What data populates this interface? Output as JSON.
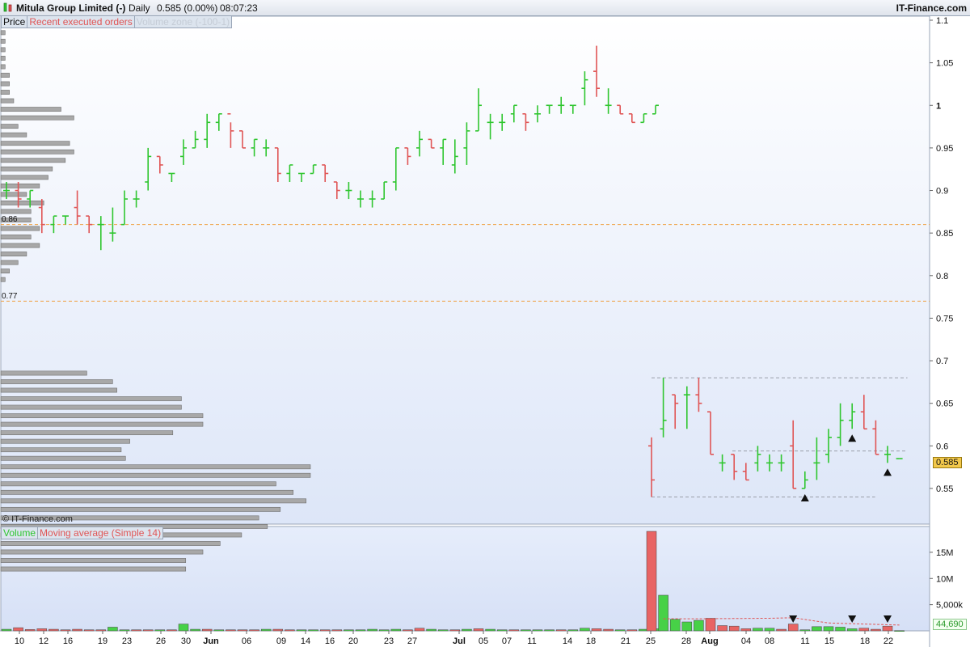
{
  "header": {
    "instrument": "Mitula Group Limited (-)",
    "period": "Daily",
    "last": "0.585 (0.00%)",
    "time": "08:07:23",
    "brand": "IT-Finance.com"
  },
  "price_panel": {
    "tab_price": "Price",
    "tab_trades": "Recent executed orders",
    "tab_volume_profile": "Volume zone (-100-1)",
    "watermark": "© IT-Finance.com",
    "level_a": "0.86",
    "level_b": "0.77",
    "last_price_tag": "0.585"
  },
  "volume_panel": {
    "tab_volume": "Volume",
    "tab_ma": "Moving average (Simple 14)",
    "last_volume_tag": "44,690"
  },
  "colors": {
    "up": "#2fc62f",
    "down": "#e05555",
    "volume_up": "#47d147",
    "volume_down": "#e86464",
    "profile_bar": "#a8a8a8",
    "level_line": "#f0a040",
    "tag_bg": "#f2c84b",
    "panel_bg_top": "#ffffff",
    "panel_bg_bottom": "#dde6f8"
  },
  "chart_data": [
    {
      "type": "ohlc",
      "ylim": [
        0.53,
        1.1
      ],
      "y_ticks": [
        "1.1",
        "1.05",
        "1",
        "0.95",
        "0.9",
        "0.85",
        "0.8",
        "0.75",
        "0.7",
        "0.65",
        "0.6",
        "0.55"
      ],
      "x_ticks": [
        "10",
        "12",
        "16",
        "19",
        "23",
        "26",
        "30",
        "Jun",
        "06",
        "09",
        "14",
        "16",
        "20",
        "23",
        "27",
        "Jul",
        "05",
        "07",
        "11",
        "14",
        "18",
        "21",
        "25",
        "28",
        "Aug",
        "04",
        "08",
        "11",
        "15",
        "18",
        "22"
      ],
      "horizontal_levels": [
        0.86,
        0.77
      ],
      "dashed_box_levels": [
        0.68,
        0.594,
        0.54
      ],
      "bars": [
        [
          0.9,
          0.91,
          0.89,
          0.9
        ],
        [
          0.9,
          0.91,
          0.88,
          0.89
        ],
        [
          0.89,
          0.9,
          0.88,
          0.9
        ],
        [
          0.88,
          0.89,
          0.85,
          0.86
        ],
        [
          0.86,
          0.87,
          0.85,
          0.87
        ],
        [
          0.87,
          0.87,
          0.86,
          0.87
        ],
        [
          0.88,
          0.9,
          0.86,
          0.87
        ],
        [
          0.87,
          0.87,
          0.85,
          0.86
        ],
        [
          0.86,
          0.87,
          0.83,
          0.86
        ],
        [
          0.85,
          0.88,
          0.84,
          0.85
        ],
        [
          0.86,
          0.9,
          0.86,
          0.89
        ],
        [
          0.89,
          0.9,
          0.88,
          0.89
        ],
        [
          0.91,
          0.95,
          0.9,
          0.94
        ],
        [
          0.94,
          0.94,
          0.92,
          0.93
        ],
        [
          0.92,
          0.92,
          0.91,
          0.92
        ],
        [
          0.94,
          0.96,
          0.93,
          0.95
        ],
        [
          0.95,
          0.97,
          0.95,
          0.96
        ],
        [
          0.96,
          0.99,
          0.95,
          0.98
        ],
        [
          0.98,
          0.99,
          0.97,
          0.99
        ],
        [
          0.99,
          0.98,
          0.95,
          0.97
        ],
        [
          0.97,
          0.97,
          0.95,
          0.95
        ],
        [
          0.95,
          0.96,
          0.94,
          0.96
        ],
        [
          0.95,
          0.96,
          0.94,
          0.95
        ],
        [
          0.95,
          0.95,
          0.91,
          0.92
        ],
        [
          0.92,
          0.93,
          0.91,
          0.93
        ],
        [
          0.92,
          0.92,
          0.91,
          0.92
        ],
        [
          0.92,
          0.93,
          0.92,
          0.93
        ],
        [
          0.93,
          0.93,
          0.91,
          0.92
        ],
        [
          0.91,
          0.91,
          0.89,
          0.9
        ],
        [
          0.9,
          0.91,
          0.89,
          0.9
        ],
        [
          0.89,
          0.9,
          0.88,
          0.89
        ],
        [
          0.89,
          0.9,
          0.88,
          0.89
        ],
        [
          0.89,
          0.91,
          0.89,
          0.91
        ],
        [
          0.91,
          0.95,
          0.9,
          0.95
        ],
        [
          0.95,
          0.95,
          0.93,
          0.94
        ],
        [
          0.95,
          0.97,
          0.94,
          0.96
        ],
        [
          0.96,
          0.96,
          0.95,
          0.95
        ],
        [
          0.95,
          0.96,
          0.93,
          0.96
        ],
        [
          0.93,
          0.96,
          0.92,
          0.94
        ],
        [
          0.95,
          0.98,
          0.93,
          0.97
        ],
        [
          0.97,
          1.02,
          0.97,
          1.0
        ],
        [
          0.98,
          0.99,
          0.96,
          0.98
        ],
        [
          0.98,
          0.99,
          0.97,
          0.98
        ],
        [
          0.99,
          1.0,
          0.98,
          1.0
        ],
        [
          0.99,
          0.99,
          0.97,
          0.98
        ],
        [
          0.99,
          1.0,
          0.98,
          0.99
        ],
        [
          1.0,
          1.0,
          0.99,
          1.0
        ],
        [
          1.0,
          1.01,
          0.99,
          1.0
        ],
        [
          1.0,
          1.0,
          0.99,
          1.0
        ],
        [
          1.02,
          1.04,
          1.0,
          1.03
        ],
        [
          1.04,
          1.07,
          1.01,
          1.02
        ],
        [
          1.0,
          1.02,
          0.99,
          1.0
        ],
        [
          1.0,
          1.0,
          0.99,
          0.99
        ],
        [
          0.99,
          0.99,
          0.98,
          0.98
        ],
        [
          0.98,
          0.99,
          0.98,
          0.99
        ],
        [
          0.99,
          1.0,
          0.99,
          1.0
        ],
        [
          0.6,
          0.61,
          0.54,
          0.56
        ],
        [
          0.62,
          0.68,
          0.61,
          0.63
        ],
        [
          0.66,
          0.66,
          0.62,
          0.65
        ],
        [
          0.66,
          0.67,
          0.62,
          0.66
        ],
        [
          0.66,
          0.68,
          0.64,
          0.65
        ],
        [
          0.64,
          0.64,
          0.59,
          0.59
        ],
        [
          0.58,
          0.59,
          0.57,
          0.58
        ],
        [
          0.59,
          0.59,
          0.56,
          0.57
        ],
        [
          0.57,
          0.58,
          0.56,
          0.56
        ],
        [
          0.58,
          0.6,
          0.57,
          0.59
        ],
        [
          0.58,
          0.59,
          0.57,
          0.58
        ],
        [
          0.58,
          0.59,
          0.57,
          0.58
        ],
        [
          0.6,
          0.63,
          0.55,
          0.55
        ],
        [
          0.55,
          0.57,
          0.55,
          0.56
        ],
        [
          0.58,
          0.61,
          0.56,
          0.58
        ],
        [
          0.59,
          0.62,
          0.58,
          0.61
        ],
        [
          0.61,
          0.65,
          0.6,
          0.63
        ],
        [
          0.63,
          0.65,
          0.62,
          0.64
        ],
        [
          0.64,
          0.66,
          0.62,
          0.62
        ],
        [
          0.62,
          0.63,
          0.59,
          0.59
        ],
        [
          0.59,
          0.6,
          0.58,
          0.59
        ],
        [
          0.585,
          0.585,
          0.585,
          0.585
        ]
      ],
      "trade_markers": [
        {
          "bar": 69,
          "direction": "up"
        },
        {
          "bar": 73,
          "direction": "up"
        },
        {
          "bar": 76,
          "direction": "up"
        }
      ],
      "volume_profile": [
        {
          "price": 1.085,
          "volume": 1
        },
        {
          "price": 1.075,
          "volume": 1
        },
        {
          "price": 1.065,
          "volume": 1
        },
        {
          "price": 1.055,
          "volume": 1
        },
        {
          "price": 1.045,
          "volume": 1
        },
        {
          "price": 1.035,
          "volume": 2
        },
        {
          "price": 1.025,
          "volume": 2
        },
        {
          "price": 1.015,
          "volume": 2
        },
        {
          "price": 1.005,
          "volume": 3
        },
        {
          "price": 0.995,
          "volume": 14
        },
        {
          "price": 0.985,
          "volume": 17
        },
        {
          "price": 0.975,
          "volume": 4
        },
        {
          "price": 0.965,
          "volume": 6
        },
        {
          "price": 0.955,
          "volume": 16
        },
        {
          "price": 0.945,
          "volume": 17
        },
        {
          "price": 0.935,
          "volume": 15
        },
        {
          "price": 0.925,
          "volume": 12
        },
        {
          "price": 0.915,
          "volume": 11
        },
        {
          "price": 0.905,
          "volume": 9
        },
        {
          "price": 0.895,
          "volume": 6
        },
        {
          "price": 0.885,
          "volume": 10
        },
        {
          "price": 0.875,
          "volume": 7
        },
        {
          "price": 0.865,
          "volume": 7
        },
        {
          "price": 0.855,
          "volume": 9
        },
        {
          "price": 0.845,
          "volume": 7
        },
        {
          "price": 0.835,
          "volume": 9
        },
        {
          "price": 0.825,
          "volume": 6
        },
        {
          "price": 0.815,
          "volume": 4
        },
        {
          "price": 0.805,
          "volume": 2
        },
        {
          "price": 0.795,
          "volume": 1
        },
        {
          "price": 0.685,
          "volume": 20
        },
        {
          "price": 0.675,
          "volume": 26
        },
        {
          "price": 0.665,
          "volume": 27
        },
        {
          "price": 0.655,
          "volume": 42
        },
        {
          "price": 0.645,
          "volume": 42
        },
        {
          "price": 0.635,
          "volume": 47
        },
        {
          "price": 0.625,
          "volume": 47
        },
        {
          "price": 0.615,
          "volume": 40
        },
        {
          "price": 0.605,
          "volume": 30
        },
        {
          "price": 0.595,
          "volume": 28
        },
        {
          "price": 0.585,
          "volume": 29
        },
        {
          "price": 0.575,
          "volume": 72
        },
        {
          "price": 0.565,
          "volume": 72
        },
        {
          "price": 0.555,
          "volume": 64
        },
        {
          "price": 0.545,
          "volume": 68
        },
        {
          "price": 0.535,
          "volume": 71
        },
        {
          "price": 0.525,
          "volume": 65
        },
        {
          "price": 0.515,
          "volume": 60
        },
        {
          "price": 0.505,
          "volume": 62
        },
        {
          "price": 0.495,
          "volume": 56
        },
        {
          "price": 0.485,
          "volume": 51
        },
        {
          "price": 0.475,
          "volume": 47
        },
        {
          "price": 0.465,
          "volume": 43
        },
        {
          "price": 0.455,
          "volume": 43
        }
      ]
    },
    {
      "type": "bar",
      "ylim": [
        0,
        19000000
      ],
      "y_ticks": [
        "15M",
        "10M",
        "5,000k"
      ],
      "y_tick_values": [
        15000000,
        10000000,
        5000000
      ],
      "volumes": [
        [
          300000,
          "up"
        ],
        [
          600000,
          "down"
        ],
        [
          250000,
          "down"
        ],
        [
          400000,
          "down"
        ],
        [
          300000,
          "down"
        ],
        [
          200000,
          "down"
        ],
        [
          300000,
          "down"
        ],
        [
          200000,
          "down"
        ],
        [
          200000,
          "down"
        ],
        [
          700000,
          "up"
        ],
        [
          200000,
          "up"
        ],
        [
          200000,
          "down"
        ],
        [
          200000,
          "down"
        ],
        [
          200000,
          "up"
        ],
        [
          200000,
          "down"
        ],
        [
          1300000,
          "up"
        ],
        [
          300000,
          "up"
        ],
        [
          300000,
          "down"
        ],
        [
          200000,
          "up"
        ],
        [
          200000,
          "down"
        ],
        [
          200000,
          "down"
        ],
        [
          200000,
          "down"
        ],
        [
          300000,
          "up"
        ],
        [
          300000,
          "down"
        ],
        [
          200000,
          "down"
        ],
        [
          200000,
          "up"
        ],
        [
          200000,
          "up"
        ],
        [
          200000,
          "down"
        ],
        [
          200000,
          "down"
        ],
        [
          200000,
          "up"
        ],
        [
          200000,
          "up"
        ],
        [
          300000,
          "up"
        ],
        [
          200000,
          "up"
        ],
        [
          300000,
          "up"
        ],
        [
          200000,
          "down"
        ],
        [
          500000,
          "down"
        ],
        [
          300000,
          "up"
        ],
        [
          200000,
          "up"
        ],
        [
          200000,
          "down"
        ],
        [
          300000,
          "up"
        ],
        [
          400000,
          "down"
        ],
        [
          300000,
          "up"
        ],
        [
          200000,
          "up"
        ],
        [
          200000,
          "down"
        ],
        [
          200000,
          "up"
        ],
        [
          200000,
          "up"
        ],
        [
          200000,
          "up"
        ],
        [
          200000,
          "down"
        ],
        [
          200000,
          "up"
        ],
        [
          500000,
          "up"
        ],
        [
          400000,
          "down"
        ],
        [
          300000,
          "down"
        ],
        [
          200000,
          "up"
        ],
        [
          200000,
          "down"
        ],
        [
          300000,
          "up"
        ],
        [
          400000,
          "up"
        ],
        [
          19000000,
          "down"
        ],
        [
          6800000,
          "up"
        ],
        [
          2200000,
          "up"
        ],
        [
          1700000,
          "up"
        ],
        [
          2000000,
          "up"
        ],
        [
          2400000,
          "down"
        ],
        [
          1000000,
          "down"
        ],
        [
          900000,
          "down"
        ],
        [
          400000,
          "down"
        ],
        [
          500000,
          "up"
        ],
        [
          500000,
          "up"
        ],
        [
          300000,
          "down"
        ],
        [
          1300000,
          "down"
        ],
        [
          200000,
          "up"
        ],
        [
          800000,
          "up"
        ],
        [
          800000,
          "up"
        ],
        [
          700000,
          "up"
        ],
        [
          400000,
          "up"
        ],
        [
          500000,
          "down"
        ],
        [
          300000,
          "down"
        ],
        [
          900000,
          "down"
        ],
        [
          44690,
          "up"
        ]
      ],
      "moving_average_points": [
        [
          57,
          2300000
        ],
        [
          60,
          2300000
        ],
        [
          66,
          2400000
        ],
        [
          68,
          2500000
        ],
        [
          71,
          1500000
        ],
        [
          74,
          1300000
        ],
        [
          77,
          1100000
        ]
      ],
      "volume_markers": [
        {
          "bar": 68,
          "direction": "down"
        },
        {
          "bar": 73,
          "direction": "down"
        },
        {
          "bar": 76,
          "direction": "down"
        }
      ]
    }
  ]
}
